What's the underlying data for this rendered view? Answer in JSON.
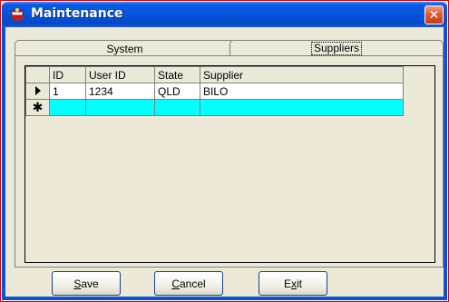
{
  "window": {
    "title": "Maintenance",
    "close_glyph": "✕",
    "icon": "app-icon"
  },
  "tabs": [
    {
      "label": "System",
      "selected": false
    },
    {
      "label": "Suppliers",
      "selected": true
    }
  ],
  "grid": {
    "columns": [
      "ID",
      "User ID",
      "State",
      "Supplier"
    ],
    "rows": [
      {
        "indicator": "current-row-arrow",
        "cells": [
          "1",
          "1234",
          "QLD",
          "BILO"
        ]
      }
    ],
    "new_row": {
      "indicator": "✱",
      "cells": [
        "",
        "",
        "",
        ""
      ]
    }
  },
  "buttons": {
    "save": {
      "mnemonic": "S",
      "rest": "ave"
    },
    "cancel": {
      "mnemonic": "C",
      "rest": "ancel"
    },
    "exit": {
      "prefix": "E",
      "mnemonic": "x",
      "rest": "it"
    }
  },
  "colors": {
    "title_bar": "#0553d8",
    "new_row_highlight": "#00ffff",
    "close_button": "#e25b35"
  }
}
